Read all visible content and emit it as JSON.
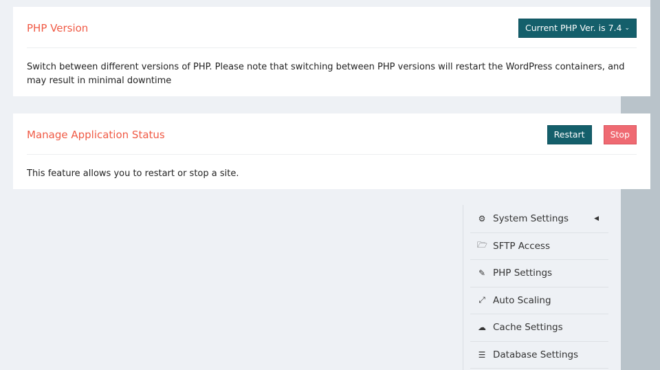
{
  "php_version": {
    "title": "PHP Version",
    "button_label": "Current PHP Ver. is 7.4",
    "description": "Switch between different versions of PHP. Please note that switching between PHP versions will restart the WordPress containers, and may result in minimal downtime"
  },
  "app_status": {
    "title": "Manage Application Status",
    "restart_label": "Restart",
    "stop_label": "Stop",
    "description": "This feature allows you to restart or stop a site."
  },
  "menu": {
    "items": [
      {
        "label": "System Settings",
        "icon": "gears-icon"
      },
      {
        "label": "SFTP Access",
        "icon": "folder-open-icon"
      },
      {
        "label": "PHP Settings",
        "icon": "edit-icon"
      },
      {
        "label": "Auto Scaling",
        "icon": "expand-icon"
      },
      {
        "label": "Cache Settings",
        "icon": "cloud-download-icon"
      },
      {
        "label": "Database Settings",
        "icon": "database-icon"
      }
    ]
  },
  "colors": {
    "accent": "#f05a45",
    "primary": "#145f6b",
    "danger": "#ef6a72"
  }
}
